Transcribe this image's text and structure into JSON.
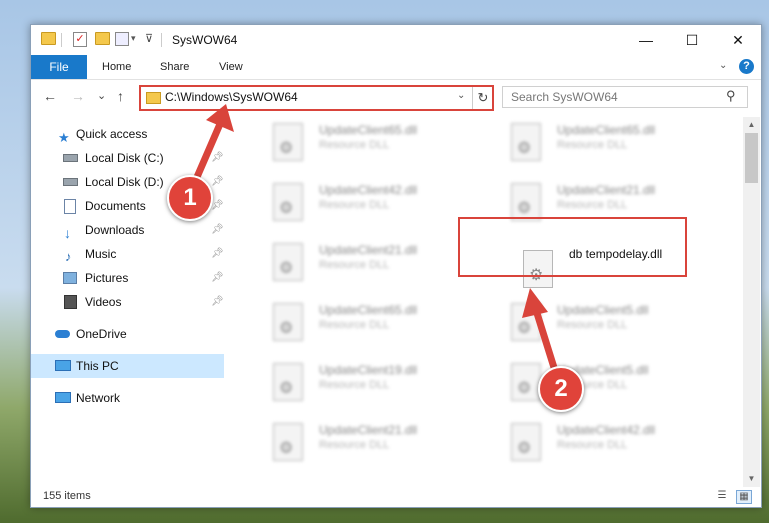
{
  "window": {
    "title": "SysWOW64",
    "minimize": "—",
    "maximize": "☐",
    "close": "✕"
  },
  "ribbon": {
    "file": "File",
    "home": "Home",
    "share": "Share",
    "view": "View",
    "help": "?"
  },
  "nav": {
    "back": "←",
    "forward": "→",
    "recent": "⌄",
    "up": "↑",
    "address": "C:\\Windows\\SysWOW64",
    "refresh": "↻",
    "search_placeholder": "Search SysWOW64"
  },
  "sidebar": {
    "items": [
      {
        "label": "Quick access",
        "icon": "star-icon",
        "pinned": false
      },
      {
        "label": "Local Disk (C:)",
        "icon": "drive-icon",
        "pinned": true
      },
      {
        "label": "Local Disk (D:)",
        "icon": "drive-icon",
        "pinned": true
      },
      {
        "label": "Documents",
        "icon": "documents-icon",
        "pinned": true
      },
      {
        "label": "Downloads",
        "icon": "download-icon",
        "pinned": true
      },
      {
        "label": "Music",
        "icon": "music-icon",
        "pinned": true
      },
      {
        "label": "Pictures",
        "icon": "pictures-icon",
        "pinned": true
      },
      {
        "label": "Videos",
        "icon": "videos-icon",
        "pinned": true
      },
      {
        "label": "OneDrive",
        "icon": "cloud-icon",
        "pinned": false
      },
      {
        "label": "This PC",
        "icon": "computer-icon",
        "pinned": false,
        "selected": true
      },
      {
        "label": "Network",
        "icon": "network-icon",
        "pinned": false
      }
    ]
  },
  "files": [
    {
      "name": "UpdateClient65.dll",
      "type": "Resource DLL"
    },
    {
      "name": "UpdateClient65.dll",
      "type": "Resource DLL"
    },
    {
      "name": "UpdateClient42.dll",
      "type": "Resource DLL"
    },
    {
      "name": "UpdateClient21.dll",
      "type": "Resource DLL"
    },
    {
      "name": "UpdateClient21.dll",
      "type": "Resource DLL"
    },
    {
      "name": "db tempodelay.dll",
      "type": ""
    },
    {
      "name": "UpdateClient65.dll",
      "type": "Resource DLL"
    },
    {
      "name": "UpdateClient5.dll",
      "type": "Resource DLL"
    },
    {
      "name": "UpdateClient19.dll",
      "type": "Resource DLL"
    },
    {
      "name": "UpdateClient5.dll",
      "type": "Resource DLL"
    },
    {
      "name": "UpdateClient21.dll",
      "type": "Resource DLL"
    },
    {
      "name": "UpdateClient42.dll",
      "type": "Resource DLL"
    }
  ],
  "status": {
    "item_count": "155 items"
  },
  "annotations": {
    "step1": "1",
    "step2": "2",
    "color": "#d9443b"
  }
}
